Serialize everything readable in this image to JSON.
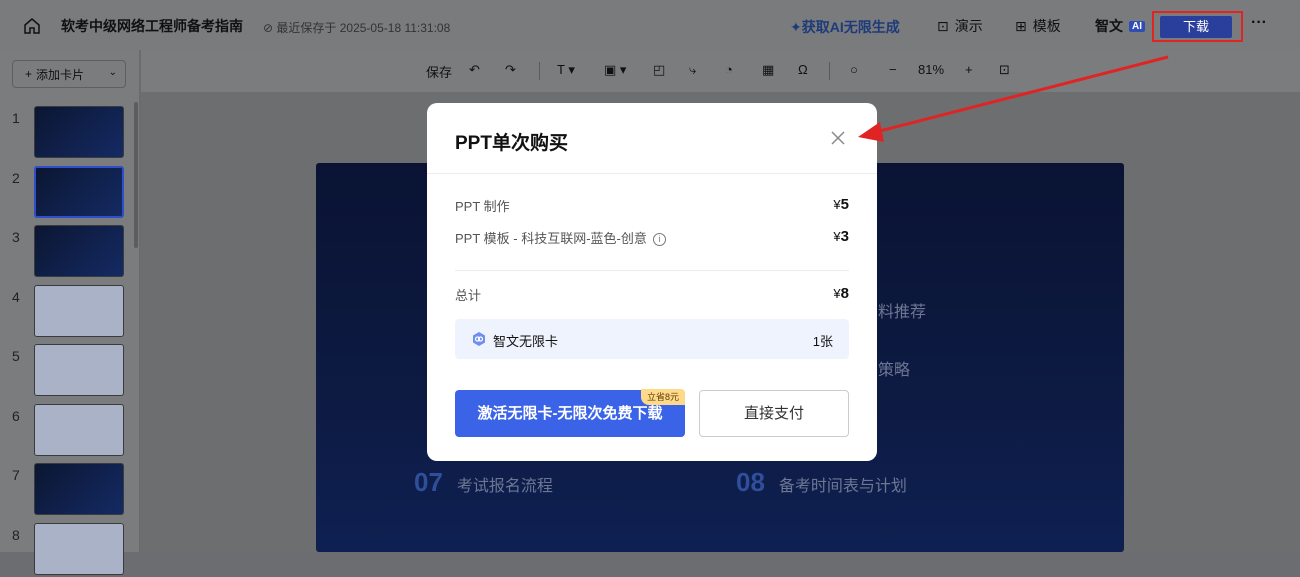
{
  "topbar": {
    "doc_title": "软考中级网络工程师备考指南",
    "saved_text": "最近保存于 2025-05-18 11:31:08",
    "get_ai": "获取AI无限生成",
    "present_label": "演示",
    "template_label": "模板",
    "zhiwen_label": "智文",
    "ai_badge": "AI",
    "download_label": "下载",
    "more_label": "···"
  },
  "sidebar": {
    "add_card_label": "添加卡片",
    "slides": [
      {
        "num": "1",
        "style": "dark"
      },
      {
        "num": "2",
        "style": "dark",
        "selected": true
      },
      {
        "num": "3",
        "style": "dark"
      },
      {
        "num": "4",
        "style": "light"
      },
      {
        "num": "5",
        "style": "light"
      },
      {
        "num": "6",
        "style": "light"
      },
      {
        "num": "7",
        "style": "dark"
      },
      {
        "num": "8",
        "style": "light"
      }
    ]
  },
  "toolbar": {
    "save_label": "保存",
    "zoom": "81%"
  },
  "slide": {
    "agenda": [
      {
        "num": "07",
        "text": "考试报名流程"
      },
      {
        "num": "08",
        "text": "备考时间表与计划"
      }
    ],
    "partial_right_1": "料推荐",
    "partial_right_2": "策略"
  },
  "modal": {
    "title": "PPT单次购买",
    "items": [
      {
        "label": "PPT 制作",
        "currency": "¥",
        "amount": "5"
      },
      {
        "label": "PPT 模板 - 科技互联网-蓝色-创意",
        "currency": "¥",
        "amount": "3"
      }
    ],
    "total_label": "总计",
    "total_currency": "¥",
    "total_amount": "8",
    "card_name": "智文无限卡",
    "card_count": "1张",
    "primary_button": "激活无限卡-无限次免费下载",
    "promo_badge": "立省8元",
    "secondary_button": "直接支付"
  },
  "colors": {
    "primary": "#3a63e8",
    "highlight_border": "#e02424",
    "download_bg": "#2a3f9c"
  }
}
